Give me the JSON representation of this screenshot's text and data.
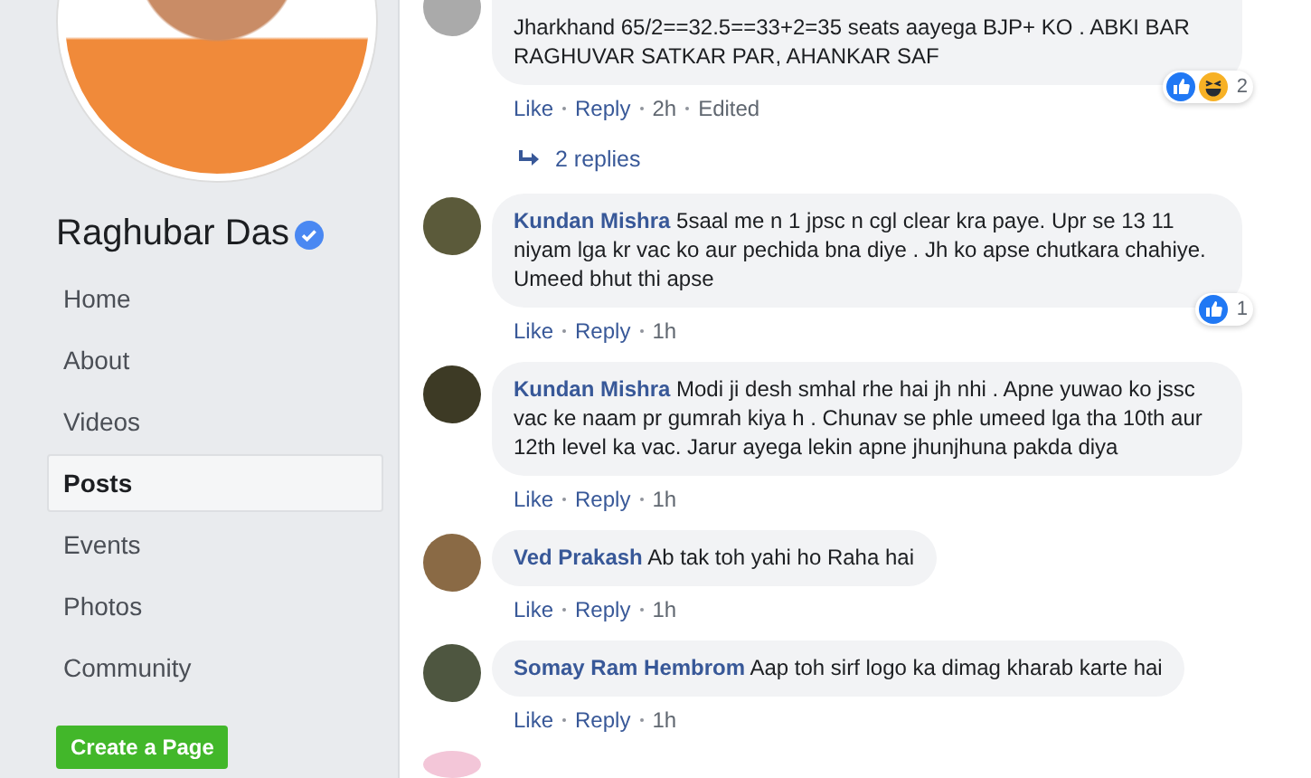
{
  "page": {
    "name": "Raghubar Das",
    "verified": true
  },
  "nav": [
    {
      "label": "Home",
      "selected": false
    },
    {
      "label": "About",
      "selected": false
    },
    {
      "label": "Videos",
      "selected": false
    },
    {
      "label": "Posts",
      "selected": true
    },
    {
      "label": "Events",
      "selected": false
    },
    {
      "label": "Photos",
      "selected": false
    },
    {
      "label": "Community",
      "selected": false
    }
  ],
  "create_button": "Create a Page",
  "comments": [
    {
      "text": "Jharkhand 65/2==32.5==33+2=35 seats aayega BJP+ KO . ABKI BAR RAGHUVAR SATKAR PAR, AHANKAR SAF",
      "actions": [
        "Like",
        "Reply",
        "2h",
        "Edited"
      ],
      "reactions": {
        "icons": [
          {
            "kind": "like"
          },
          {
            "kind": "haha"
          }
        ],
        "count": "2"
      },
      "replies": "2 replies"
    },
    {
      "author": "Kundan Mishra",
      "text": "5saal me n 1 jpsc n cgl clear kra paye. Upr se 13 11 niyam lga kr vac ko aur pechida bna diye . Jh ko apse chutkara chahiye. Umeed bhut thi apse",
      "actions": [
        "Like",
        "Reply",
        "1h"
      ],
      "reactions": {
        "icons": [
          {
            "kind": "like"
          }
        ],
        "count": "1"
      }
    },
    {
      "author": "Kundan Mishra",
      "text": "Modi ji desh smhal rhe hai jh nhi . Apne yuwao ko jssc vac ke naam pr gumrah kiya h . Chunav se phle umeed lga tha 10th aur 12th level ka vac. Jarur ayega lekin apne jhunjhuna pakda diya",
      "actions": [
        "Like",
        "Reply",
        "1h"
      ]
    },
    {
      "author": "Ved Prakash",
      "text": "Ab tak toh yahi ho Raha hai",
      "actions": [
        "Like",
        "Reply",
        "1h"
      ]
    },
    {
      "author": "Somay Ram Hembrom",
      "text": "Aap toh sirf logo ka dimag kharab karte hai",
      "actions": [
        "Like",
        "Reply",
        "1h"
      ]
    }
  ]
}
